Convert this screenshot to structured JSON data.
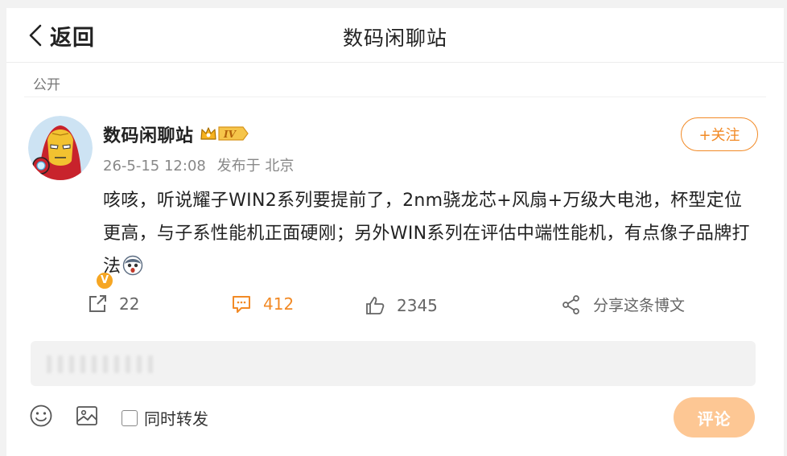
{
  "header": {
    "back_label": "返回",
    "title": "数码闲聊站"
  },
  "post": {
    "visibility": "公开",
    "author": {
      "name": "数码闲聊站",
      "level_badge": "IV",
      "verified_mark": "V"
    },
    "timestamp": "26-5-15 12:08",
    "source": "发布于 北京",
    "follow_label": "+关注",
    "content": "咳咳，听说耀子WIN2系列要提前了，2nm骁龙芯+风扇+万级大电池，杯型定位更高，与子系性能机正面硬刚；另外WIN系列在评估中端性能机，有点像子品牌打法",
    "emoji": "surprised-face-emoji"
  },
  "actions": {
    "repost_count": "22",
    "comment_count": "412",
    "like_count": "2345",
    "share_label": "分享这条博文"
  },
  "comment_box": {
    "input_value": "",
    "placeholder": "",
    "same_time_repost_label": "同时转发",
    "submit_label": "评论"
  },
  "colors": {
    "accent": "#f28a26",
    "submit_disabled": "#fdc794",
    "badge": "#f6a623"
  }
}
